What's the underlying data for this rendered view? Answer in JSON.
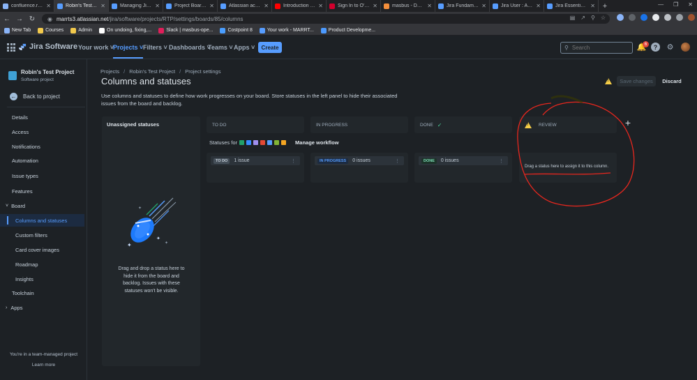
{
  "browser": {
    "tabs": [
      {
        "label": "confluence.riverma",
        "color": "#8ab4f8"
      },
      {
        "label": "Robin's Test Project",
        "color": "#579dff"
      },
      {
        "label": "Managing Jira Projects",
        "color": "#579dff"
      },
      {
        "label": "Project Boards - Atlassian",
        "color": "#579dff"
      },
      {
        "label": "Atlassian account",
        "color": "#579dff"
      },
      {
        "label": "Introduction to Jira",
        "color": "#ff0000"
      },
      {
        "label": "Sign In to O'Reilly",
        "color": "#d3002d"
      },
      {
        "label": "masbus - David",
        "color": "#f58f3b"
      },
      {
        "label": "Jira Fundamentals",
        "color": "#579dff"
      },
      {
        "label": "Jira User : Atlassian",
        "color": "#579dff"
      },
      {
        "label": "Jira Essentials with",
        "color": "#579dff"
      }
    ],
    "url_host": "marrts3.atlassian.net",
    "url_path": "/jira/software/projects/RTP/settings/boards/85/columns",
    "bookmarks": [
      {
        "label": "New Tab",
        "color": "#8ab4f8"
      },
      {
        "label": "Courses",
        "color": "#f2c94c"
      },
      {
        "label": "Admin",
        "color": "#f2c94c"
      },
      {
        "label": "On undoing, fixing,...",
        "color": "#ffffff"
      },
      {
        "label": "Slack | masbus-ope...",
        "color": "#e01e5a"
      },
      {
        "label": "Costpoint 8",
        "color": "#4a9eff"
      },
      {
        "label": "Your work - MARRT...",
        "color": "#579dff"
      },
      {
        "label": "Product Developme...",
        "color": "#4c9aff"
      }
    ]
  },
  "topnav": {
    "brand": "Jira Software",
    "items": [
      "Your work",
      "Projects",
      "Filters",
      "Dashboards",
      "Teams",
      "Apps"
    ],
    "selected": "Projects",
    "create_label": "Create",
    "search_placeholder": "Search",
    "notification_count": "6"
  },
  "sidebar": {
    "project_name": "Robin's Test Project",
    "project_type": "Software project",
    "back_label": "Back to project",
    "items": [
      {
        "label": "Details"
      },
      {
        "label": "Access"
      },
      {
        "label": "Notifications"
      },
      {
        "label": "Automation"
      },
      {
        "label": "Issue types"
      },
      {
        "label": "Features"
      },
      {
        "label": "Board"
      },
      {
        "label": "Columns and statuses"
      },
      {
        "label": "Custom filters"
      },
      {
        "label": "Card cover images"
      },
      {
        "label": "Roadmap"
      },
      {
        "label": "Insights"
      },
      {
        "label": "Toolchain"
      },
      {
        "label": "Apps"
      }
    ],
    "footer_text": "You're in a team-managed project",
    "learn_more": "Learn more"
  },
  "main": {
    "breadcrumb": [
      "Projects",
      "Robin's Test Project",
      "Project settings"
    ],
    "title": "Columns and statuses",
    "save_label": "Save changes",
    "discard_label": "Discard",
    "description": "Use columns and statuses to define how work progresses on your board. Store statuses in the left panel to hide their associated issues from the board and backlog.",
    "unassigned": {
      "heading": "Unassigned statuses",
      "text": "Drag and drop a status here to hide it from the board and backlog. Issues with these statuses won't be visible."
    },
    "statuses_for_label": "Statuses for",
    "manage_workflow": "Manage workflow",
    "columns": [
      {
        "name": "TO DO",
        "status": "TO DO",
        "count": "1 issue",
        "lozenge_bg": "#454f59",
        "lozenge_fg": "#c7d1db"
      },
      {
        "name": "IN PROGRESS",
        "status": "IN PROGRESS",
        "count": "0 issues",
        "lozenge_bg": "#1c2b41",
        "lozenge_fg": "#579dff"
      },
      {
        "name": "DONE",
        "status": "DONE",
        "count": "0 issues",
        "lozenge_bg": "#1c3329",
        "lozenge_fg": "#7ee2b8"
      },
      {
        "name": "REVIEW",
        "empty_text": "Drag a status here to assign it to this column."
      }
    ]
  },
  "colors": {
    "accent": "#579dff",
    "annotation": "#e8271e",
    "warning": "#f5cd47"
  }
}
